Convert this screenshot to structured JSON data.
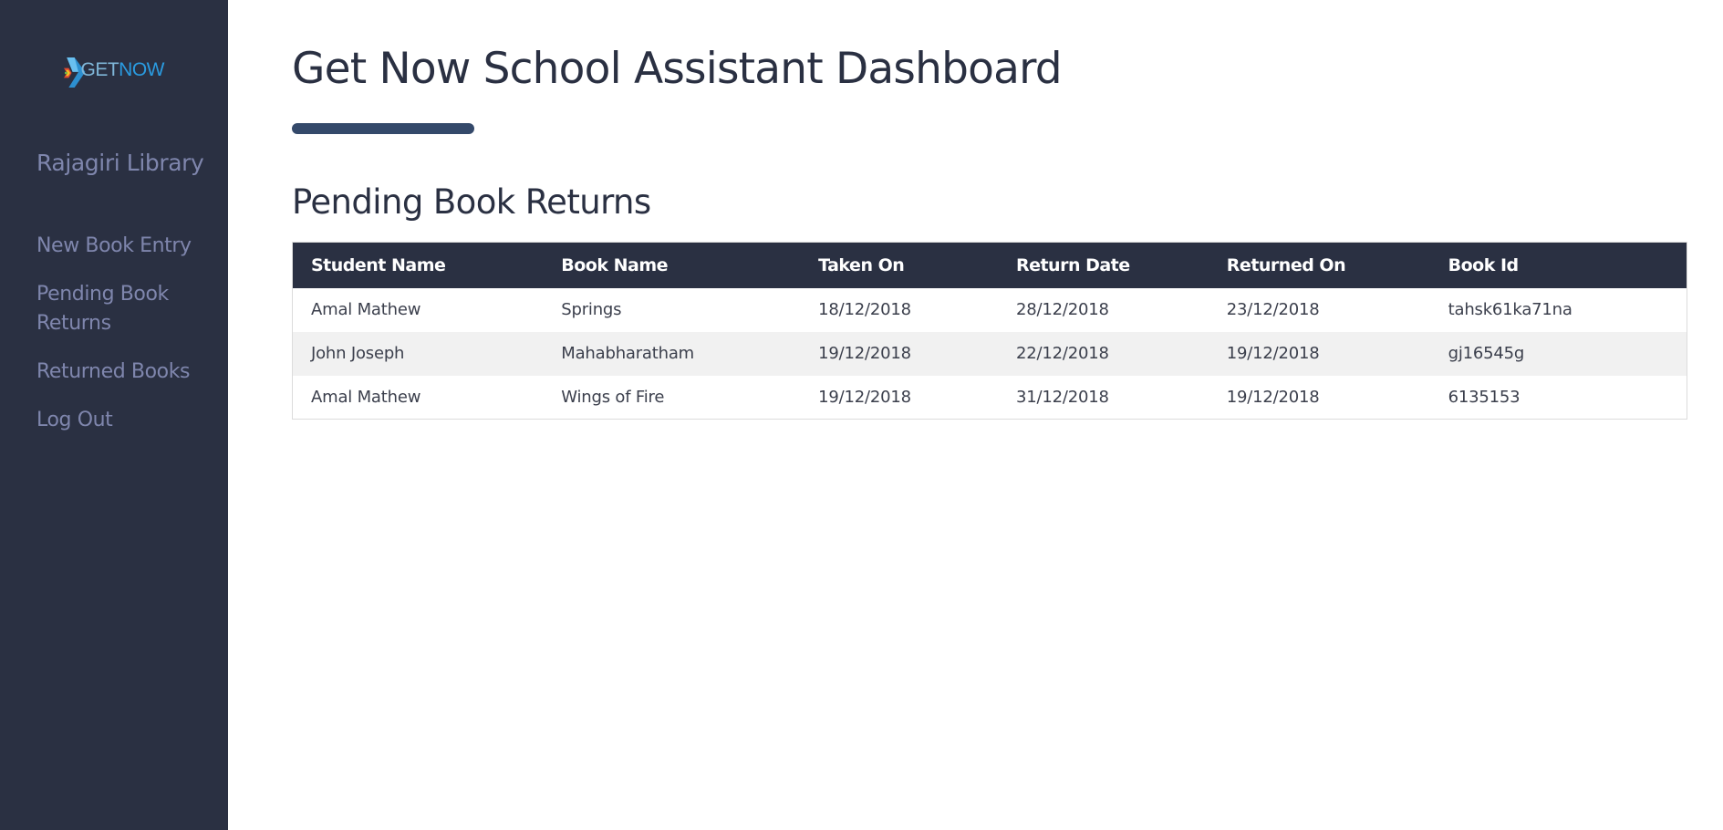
{
  "sidebar": {
    "logo": {
      "get": "GET",
      "now": "NOW"
    },
    "library_name": "Rajagiri Library",
    "nav": [
      {
        "label": "New Book Entry"
      },
      {
        "label": "Pending Book Returns"
      },
      {
        "label": "Returned Books"
      },
      {
        "label": "Log Out"
      }
    ]
  },
  "main": {
    "title": "Get Now School Assistant Dashboard",
    "section_title": "Pending Book Returns",
    "table": {
      "headers": [
        "Student Name",
        "Book Name",
        "Taken On",
        "Return Date",
        "Returned On",
        "Book Id"
      ],
      "rows": [
        [
          "Amal Mathew",
          "Springs",
          "18/12/2018",
          "28/12/2018",
          "23/12/2018",
          "tahsk61ka71na"
        ],
        [
          "John Joseph",
          "Mahabharatham",
          "19/12/2018",
          "22/12/2018",
          "19/12/2018",
          "gj16545g"
        ],
        [
          "Amal Mathew",
          "Wings of Fire",
          "19/12/2018",
          "31/12/2018",
          "19/12/2018",
          "6135153"
        ]
      ]
    }
  },
  "colors": {
    "sidebar_bg": "#2a3042",
    "sidebar_text": "#7f86ad",
    "header_bg": "#2a3042",
    "accent_bar": "#34496a"
  }
}
